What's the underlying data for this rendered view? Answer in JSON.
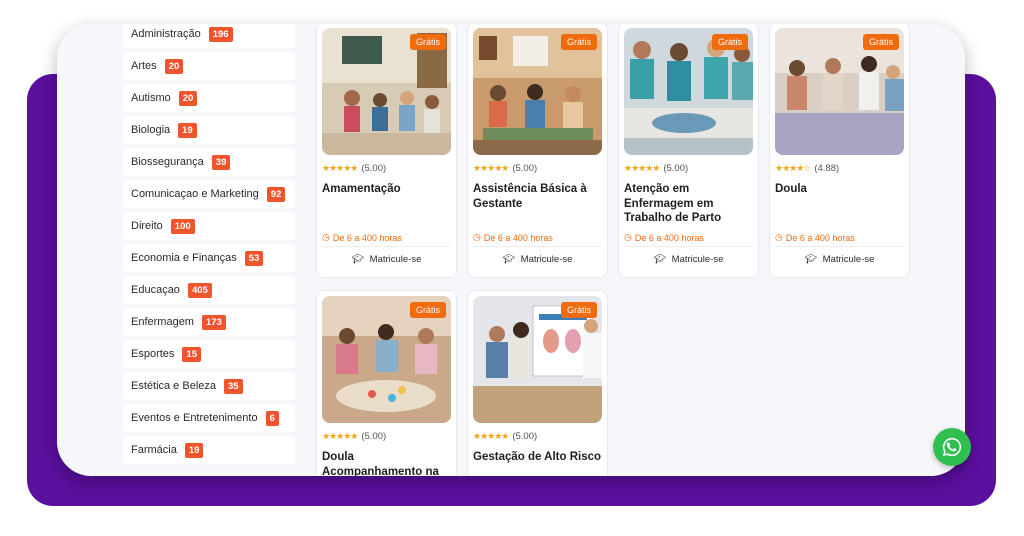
{
  "categories": [
    {
      "label": "Administração",
      "count": "196"
    },
    {
      "label": "Artes",
      "count": "20"
    },
    {
      "label": "Autismo",
      "count": "20"
    },
    {
      "label": "Biologia",
      "count": "19"
    },
    {
      "label": "Biossegurança",
      "count": "39"
    },
    {
      "label": "Comunicaçao e Marketing",
      "count": "92"
    },
    {
      "label": "Direito",
      "count": "100"
    },
    {
      "label": "Economia e Finanças",
      "count": "53"
    },
    {
      "label": "Educaçao",
      "count": "405"
    },
    {
      "label": "Enfermagem",
      "count": "173"
    },
    {
      "label": "Esportes",
      "count": "15"
    },
    {
      "label": "Estética e Beleza",
      "count": "35"
    },
    {
      "label": "Eventos e Entretenimento",
      "count": "6"
    },
    {
      "label": "Farmácia",
      "count": "19"
    }
  ],
  "courses": [
    {
      "badge": "Grátis",
      "stars": "★★★★★",
      "score": "(5.00)",
      "title": "Amamentação",
      "hours": "De 6 a 400 horas",
      "enroll": "Matricule-se"
    },
    {
      "badge": "Grátis",
      "stars": "★★★★★",
      "score": "(5.00)",
      "title": "Assistência Básica à Gestante",
      "hours": "De 6 a 400 horas",
      "enroll": "Matricule-se"
    },
    {
      "badge": "Grátis",
      "stars": "★★★★★",
      "score": "(5.00)",
      "title": "Atenção em Enfermagem em Trabalho de Parto",
      "hours": "De 6 a 400 horas",
      "enroll": "Matricule-se"
    },
    {
      "badge": "Grátis",
      "stars": "★★★★☆",
      "score": "(4.88)",
      "title": "Doula",
      "hours": "De 6 a 400 horas",
      "enroll": "Matricule-se"
    },
    {
      "badge": "Grátis",
      "stars": "★★★★★",
      "score": "(5.00)",
      "title": "Doula Acompanhamento na",
      "hours": "",
      "enroll": ""
    },
    {
      "badge": "Grátis",
      "stars": "★★★★★",
      "score": "(5.00)",
      "title": "Gestação de Alto Risco",
      "hours": "",
      "enroll": ""
    }
  ],
  "icons": {
    "clock": "clock-icon",
    "graduation_cap": "graduation-cap-icon",
    "whatsapp": "whatsapp-icon"
  },
  "colors": {
    "brand_purple": "#5b0f9e",
    "badge_red": "#f0542d",
    "accent_orange": "#f06a0e",
    "star_gold": "#f2a516",
    "whatsapp_green": "#2fbf4f"
  }
}
